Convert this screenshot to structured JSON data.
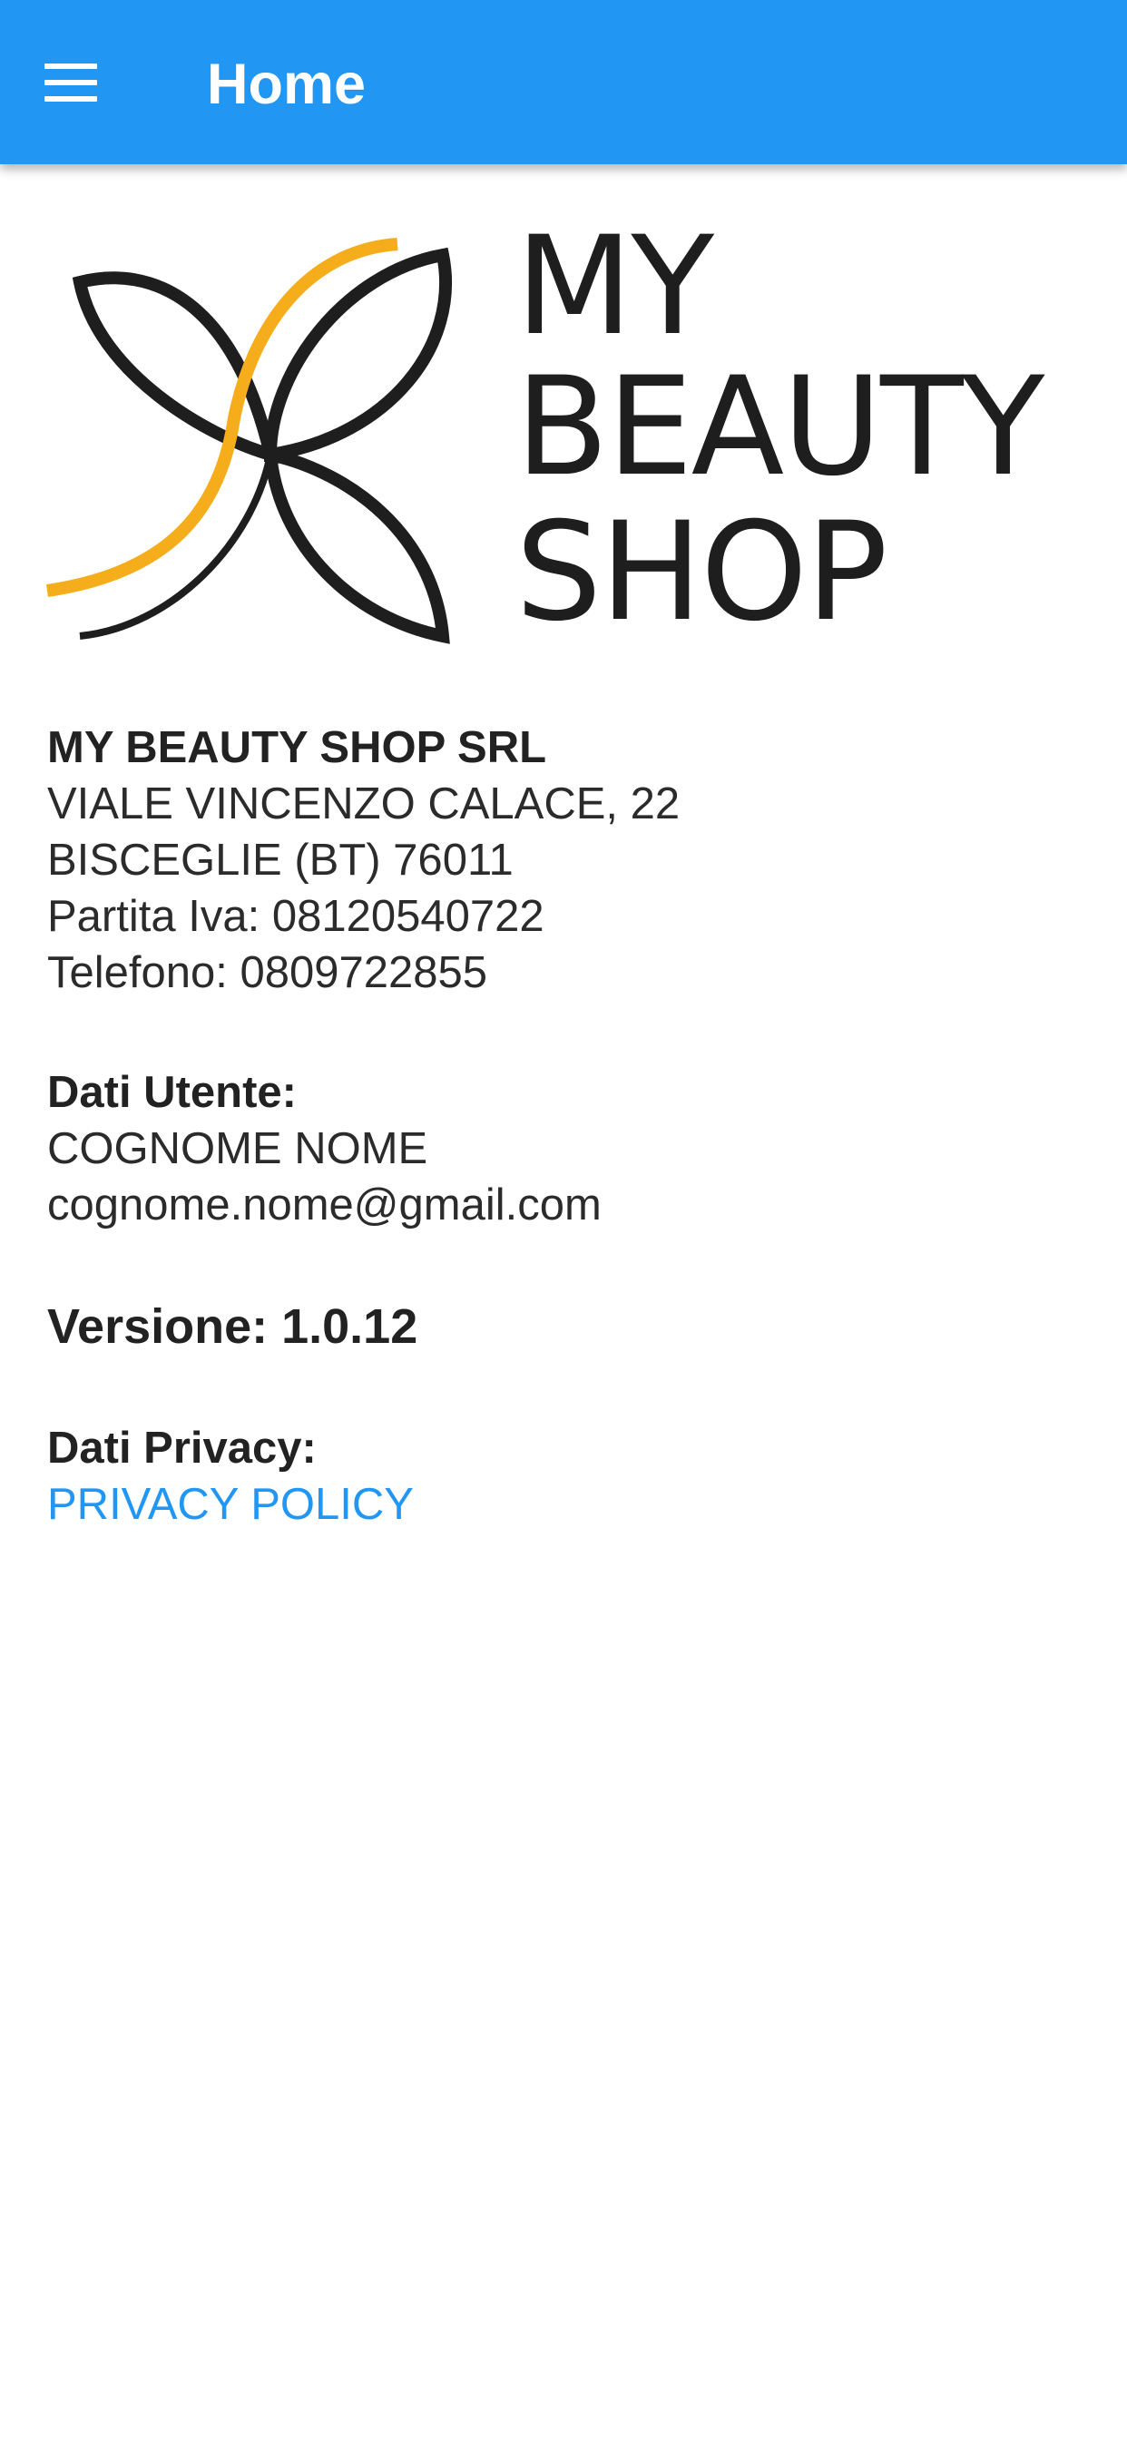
{
  "app_bar": {
    "title": "Home",
    "menu_icon": "hamburger-menu-icon",
    "background_color": "#2196f3"
  },
  "logo": {
    "brand_text": [
      "MY",
      "BEAUTY",
      "SHOP"
    ],
    "accent_color": "#f5ad1b"
  },
  "company": {
    "name": "MY BEAUTY SHOP SRL",
    "address": "VIALE VINCENZO CALACE, 22",
    "city": "BISCEGLIE (BT) 76011",
    "vat": "Partita Iva: 08120540722",
    "phone": "Telefono: 0809722855"
  },
  "user": {
    "heading": "Dati Utente:",
    "name": "COGNOME NOME",
    "email": "cognome.nome@gmail.com"
  },
  "version": {
    "label": "Versione: 1.0.12"
  },
  "privacy": {
    "heading": "Dati Privacy:",
    "link_label": "PRIVACY POLICY",
    "link_color": "#2196f3"
  }
}
